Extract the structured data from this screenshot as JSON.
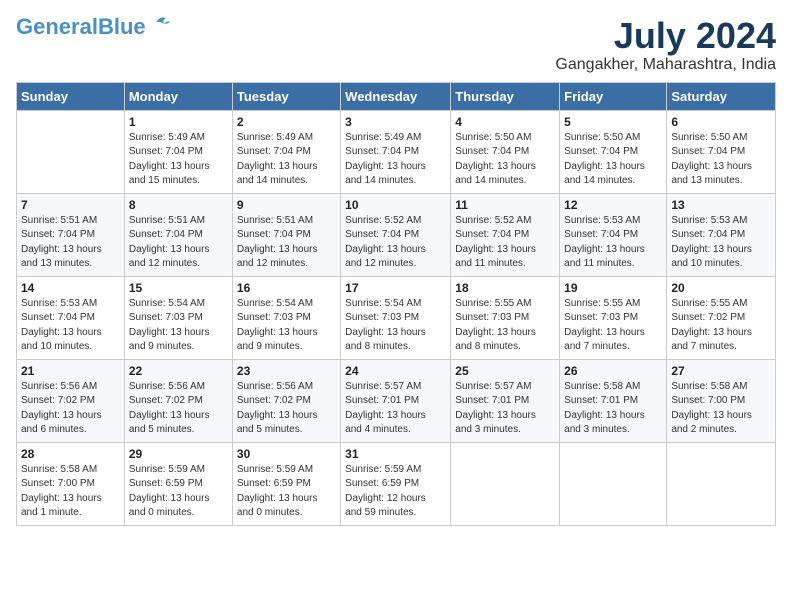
{
  "header": {
    "logo_general": "General",
    "logo_blue": "Blue",
    "month_year": "July 2024",
    "location": "Gangakher, Maharashtra, India"
  },
  "days_of_week": [
    "Sunday",
    "Monday",
    "Tuesday",
    "Wednesday",
    "Thursday",
    "Friday",
    "Saturday"
  ],
  "weeks": [
    [
      {
        "day": "",
        "info": ""
      },
      {
        "day": "1",
        "info": "Sunrise: 5:49 AM\nSunset: 7:04 PM\nDaylight: 13 hours\nand 15 minutes."
      },
      {
        "day": "2",
        "info": "Sunrise: 5:49 AM\nSunset: 7:04 PM\nDaylight: 13 hours\nand 14 minutes."
      },
      {
        "day": "3",
        "info": "Sunrise: 5:49 AM\nSunset: 7:04 PM\nDaylight: 13 hours\nand 14 minutes."
      },
      {
        "day": "4",
        "info": "Sunrise: 5:50 AM\nSunset: 7:04 PM\nDaylight: 13 hours\nand 14 minutes."
      },
      {
        "day": "5",
        "info": "Sunrise: 5:50 AM\nSunset: 7:04 PM\nDaylight: 13 hours\nand 14 minutes."
      },
      {
        "day": "6",
        "info": "Sunrise: 5:50 AM\nSunset: 7:04 PM\nDaylight: 13 hours\nand 13 minutes."
      }
    ],
    [
      {
        "day": "7",
        "info": "Sunrise: 5:51 AM\nSunset: 7:04 PM\nDaylight: 13 hours\nand 13 minutes."
      },
      {
        "day": "8",
        "info": "Sunrise: 5:51 AM\nSunset: 7:04 PM\nDaylight: 13 hours\nand 12 minutes."
      },
      {
        "day": "9",
        "info": "Sunrise: 5:51 AM\nSunset: 7:04 PM\nDaylight: 13 hours\nand 12 minutes."
      },
      {
        "day": "10",
        "info": "Sunrise: 5:52 AM\nSunset: 7:04 PM\nDaylight: 13 hours\nand 12 minutes."
      },
      {
        "day": "11",
        "info": "Sunrise: 5:52 AM\nSunset: 7:04 PM\nDaylight: 13 hours\nand 11 minutes."
      },
      {
        "day": "12",
        "info": "Sunrise: 5:53 AM\nSunset: 7:04 PM\nDaylight: 13 hours\nand 11 minutes."
      },
      {
        "day": "13",
        "info": "Sunrise: 5:53 AM\nSunset: 7:04 PM\nDaylight: 13 hours\nand 10 minutes."
      }
    ],
    [
      {
        "day": "14",
        "info": "Sunrise: 5:53 AM\nSunset: 7:04 PM\nDaylight: 13 hours\nand 10 minutes."
      },
      {
        "day": "15",
        "info": "Sunrise: 5:54 AM\nSunset: 7:03 PM\nDaylight: 13 hours\nand 9 minutes."
      },
      {
        "day": "16",
        "info": "Sunrise: 5:54 AM\nSunset: 7:03 PM\nDaylight: 13 hours\nand 9 minutes."
      },
      {
        "day": "17",
        "info": "Sunrise: 5:54 AM\nSunset: 7:03 PM\nDaylight: 13 hours\nand 8 minutes."
      },
      {
        "day": "18",
        "info": "Sunrise: 5:55 AM\nSunset: 7:03 PM\nDaylight: 13 hours\nand 8 minutes."
      },
      {
        "day": "19",
        "info": "Sunrise: 5:55 AM\nSunset: 7:03 PM\nDaylight: 13 hours\nand 7 minutes."
      },
      {
        "day": "20",
        "info": "Sunrise: 5:55 AM\nSunset: 7:02 PM\nDaylight: 13 hours\nand 7 minutes."
      }
    ],
    [
      {
        "day": "21",
        "info": "Sunrise: 5:56 AM\nSunset: 7:02 PM\nDaylight: 13 hours\nand 6 minutes."
      },
      {
        "day": "22",
        "info": "Sunrise: 5:56 AM\nSunset: 7:02 PM\nDaylight: 13 hours\nand 5 minutes."
      },
      {
        "day": "23",
        "info": "Sunrise: 5:56 AM\nSunset: 7:02 PM\nDaylight: 13 hours\nand 5 minutes."
      },
      {
        "day": "24",
        "info": "Sunrise: 5:57 AM\nSunset: 7:01 PM\nDaylight: 13 hours\nand 4 minutes."
      },
      {
        "day": "25",
        "info": "Sunrise: 5:57 AM\nSunset: 7:01 PM\nDaylight: 13 hours\nand 3 minutes."
      },
      {
        "day": "26",
        "info": "Sunrise: 5:58 AM\nSunset: 7:01 PM\nDaylight: 13 hours\nand 3 minutes."
      },
      {
        "day": "27",
        "info": "Sunrise: 5:58 AM\nSunset: 7:00 PM\nDaylight: 13 hours\nand 2 minutes."
      }
    ],
    [
      {
        "day": "28",
        "info": "Sunrise: 5:58 AM\nSunset: 7:00 PM\nDaylight: 13 hours\nand 1 minute."
      },
      {
        "day": "29",
        "info": "Sunrise: 5:59 AM\nSunset: 6:59 PM\nDaylight: 13 hours\nand 0 minutes."
      },
      {
        "day": "30",
        "info": "Sunrise: 5:59 AM\nSunset: 6:59 PM\nDaylight: 13 hours\nand 0 minutes."
      },
      {
        "day": "31",
        "info": "Sunrise: 5:59 AM\nSunset: 6:59 PM\nDaylight: 12 hours\nand 59 minutes."
      },
      {
        "day": "",
        "info": ""
      },
      {
        "day": "",
        "info": ""
      },
      {
        "day": "",
        "info": ""
      }
    ]
  ]
}
